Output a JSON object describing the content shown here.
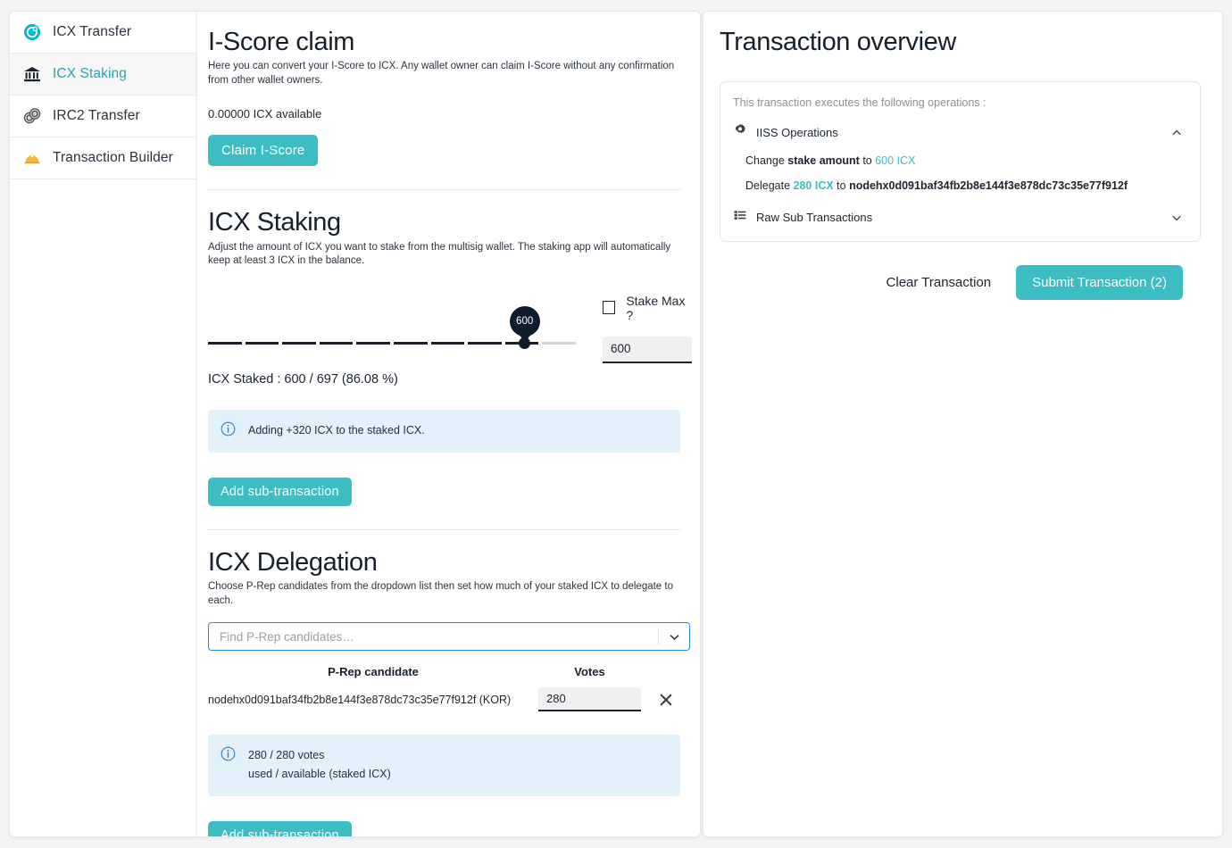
{
  "sidebar": {
    "items": [
      {
        "label": "ICX Transfer",
        "icon": "icx-logo-icon",
        "active": false
      },
      {
        "label": "ICX Staking",
        "icon": "bank-icon",
        "active": true
      },
      {
        "label": "IRC2 Transfer",
        "icon": "coins-icon",
        "active": false
      },
      {
        "label": "Transaction Builder",
        "icon": "hardhat-icon",
        "active": false
      }
    ]
  },
  "iscore": {
    "title": "I-Score claim",
    "description": "Here you can convert your I-Score to ICX. Any wallet owner can claim I-Score without any confirmation from other wallet owners.",
    "available": "0.00000 ICX available",
    "claim_button": "Claim I-Score"
  },
  "staking": {
    "title": "ICX Staking",
    "description": "Adjust the amount of ICX you want to stake from the multisig wallet. The staking app will automatically keep at least 3 ICX in the balance.",
    "slider_value": "600",
    "slider_percent": 86.08,
    "checkbox_label": "Stake Max ?",
    "checkbox_checked": false,
    "amount_input": "600",
    "staked_line": "ICX Staked : 600 / 697 (86.08 %)",
    "info_text": "Adding +320 ICX to the staked ICX.",
    "add_button": "Add sub-transaction"
  },
  "delegation": {
    "title": "ICX Delegation",
    "description": "Choose P-Rep candidates from the dropdown list then set how much of your staked ICX to delegate to each.",
    "select_placeholder": "Find P-Rep candidates…",
    "columns": {
      "candidate": "P-Rep candidate",
      "votes": "Votes"
    },
    "rows": [
      {
        "candidate": "nodehx0d091baf34fb2b8e144f3e878dc73c35e77f912f (KOR)",
        "votes": "280"
      }
    ],
    "info_line1": "280 / 280 votes",
    "info_line2": "used / available (staked ICX)",
    "add_button": "Add sub-transaction"
  },
  "overview": {
    "title": "Transaction overview",
    "lead": "This transaction executes the following operations :",
    "group_iiss": "IISS Operations",
    "group_raw": "Raw Sub Transactions",
    "op1": {
      "pre": "Change ",
      "bold": "stake amount",
      "mid": " to ",
      "accent": "600 ICX"
    },
    "op2": {
      "pre": "Delegate ",
      "accent": "280 ICX",
      "mid": " to ",
      "bold": "nodehx0d091baf34fb2b8e144f3e878dc73c35e77f912f"
    },
    "clear_button": "Clear Transaction",
    "submit_button": "Submit Transaction (2)"
  },
  "colors": {
    "accent": "#3cbcc3",
    "info_bg": "#e3f1fb",
    "slider_dark": "#0d1b2a",
    "focus_blue": "#2684ff"
  }
}
